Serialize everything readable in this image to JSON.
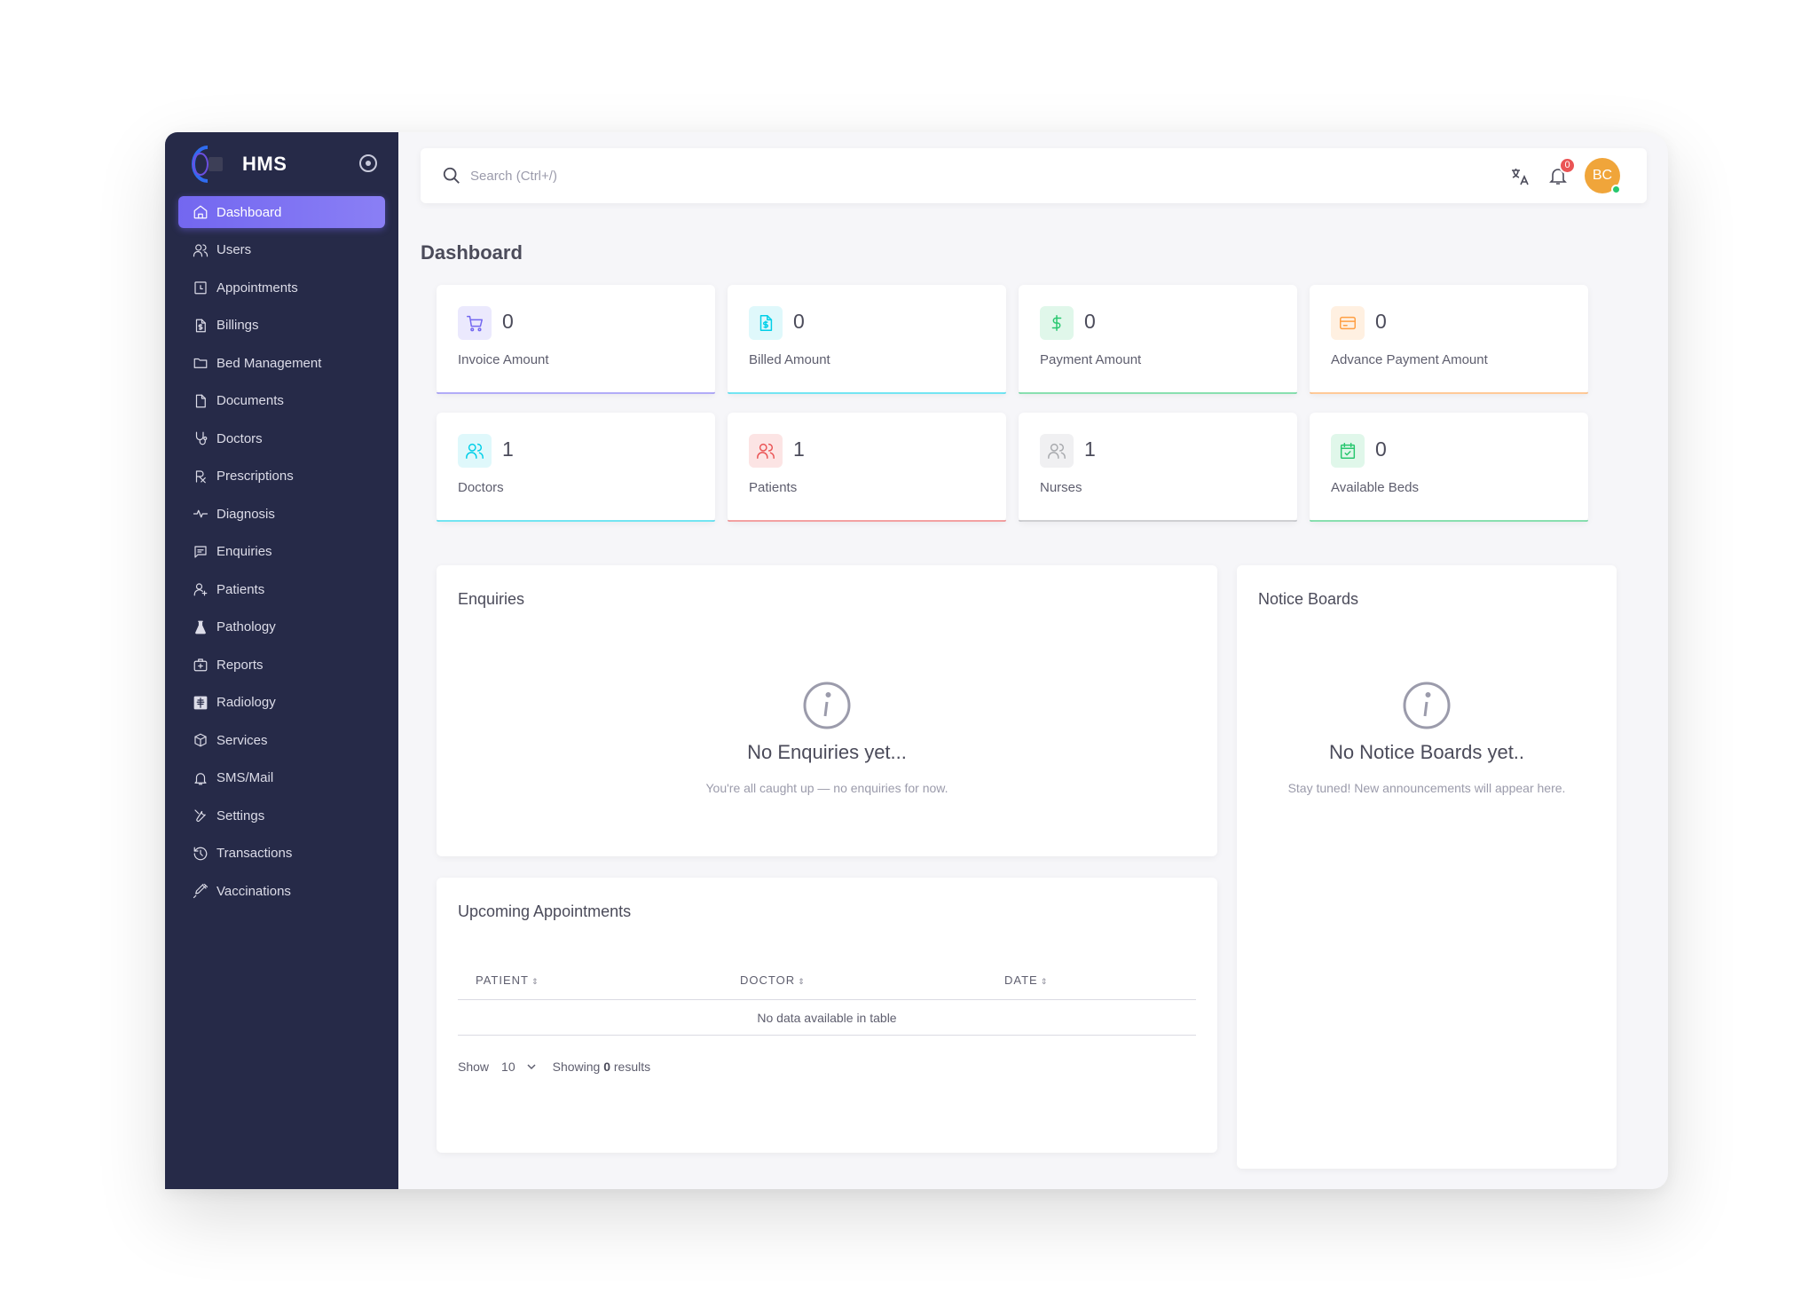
{
  "app": {
    "name": "HMS"
  },
  "sidebar": {
    "items": [
      {
        "label": "Dashboard",
        "icon": "home-icon",
        "active": true
      },
      {
        "label": "Users",
        "icon": "users-icon"
      },
      {
        "label": "Appointments",
        "icon": "calendar-icon"
      },
      {
        "label": "Billings",
        "icon": "file-dollar-icon"
      },
      {
        "label": "Bed Management",
        "icon": "folder-icon"
      },
      {
        "label": "Documents",
        "icon": "document-icon"
      },
      {
        "label": "Doctors",
        "icon": "stethoscope-icon"
      },
      {
        "label": "Prescriptions",
        "icon": "prescription-icon"
      },
      {
        "label": "Diagnosis",
        "icon": "pulse-icon"
      },
      {
        "label": "Enquiries",
        "icon": "message-icon"
      },
      {
        "label": "Patients",
        "icon": "user-plus-icon"
      },
      {
        "label": "Pathology",
        "icon": "flask-icon"
      },
      {
        "label": "Reports",
        "icon": "first-aid-kit-icon"
      },
      {
        "label": "Radiology",
        "icon": "xray-icon"
      },
      {
        "label": "Services",
        "icon": "box-icon"
      },
      {
        "label": "SMS/Mail",
        "icon": "bell-icon"
      },
      {
        "label": "Settings",
        "icon": "wrench-icon"
      },
      {
        "label": "Transactions",
        "icon": "history-icon"
      },
      {
        "label": "Vaccinations",
        "icon": "syringe-icon"
      }
    ]
  },
  "topbar": {
    "search_placeholder": "Search (Ctrl+/)",
    "notification_count": "0",
    "avatar_initials": "BC"
  },
  "page": {
    "title": "Dashboard"
  },
  "stats": [
    {
      "value": "0",
      "label": "Invoice Amount",
      "icon": "cart-icon",
      "color": "#7367f0",
      "bg": "#ebe9fd"
    },
    {
      "value": "0",
      "label": "Billed Amount",
      "icon": "file-dollar-icon",
      "color": "#00cfe8",
      "bg": "#dff8fb"
    },
    {
      "value": "0",
      "label": "Payment Amount",
      "icon": "dollar-icon",
      "color": "#28c76f",
      "bg": "#e0f7ea"
    },
    {
      "value": "0",
      "label": "Advance Payment Amount",
      "icon": "credit-card-icon",
      "color": "#ff9f43",
      "bg": "#fff0e1"
    },
    {
      "value": "1",
      "label": "Doctors",
      "icon": "users-icon",
      "color": "#00cfe8",
      "bg": "#dff8fb"
    },
    {
      "value": "1",
      "label": "Patients",
      "icon": "users-icon",
      "color": "#ea5455",
      "bg": "#fce4e4"
    },
    {
      "value": "1",
      "label": "Nurses",
      "icon": "users-icon",
      "color": "#a8aaae",
      "bg": "#f0f0f2"
    },
    {
      "value": "0",
      "label": "Available Beds",
      "icon": "calendar-check-icon",
      "color": "#28c76f",
      "bg": "#e0f7ea"
    }
  ],
  "enquiries": {
    "title": "Enquiries",
    "empty_title": "No Enquiries yet...",
    "empty_sub": "You're all caught up — no enquiries for now."
  },
  "notice_boards": {
    "title": "Notice Boards",
    "empty_title": "No Notice Boards yet..",
    "empty_sub": "Stay tuned! New announcements will appear here."
  },
  "appointments": {
    "title": "Upcoming Appointments",
    "columns": [
      "PATIENT",
      "DOCTOR",
      "DATE"
    ],
    "empty": "No data available in table",
    "show_label": "Show",
    "page_size": "10",
    "showing_prefix": "Showing",
    "showing_count": "0",
    "showing_suffix": "results"
  }
}
